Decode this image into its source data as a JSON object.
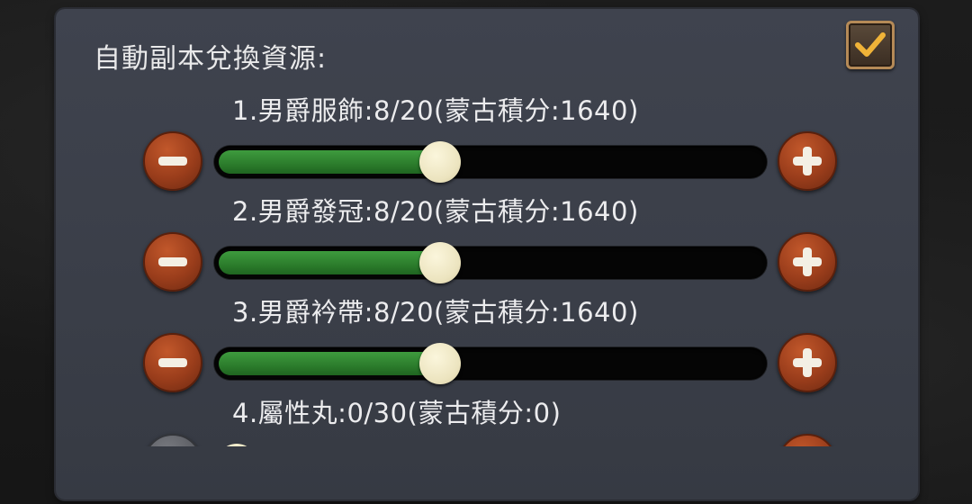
{
  "panel": {
    "title": "自動副本兌換資源:",
    "auto_exchange_checked": true
  },
  "colors": {
    "panel_bg": "#3c404a",
    "fill_green": "#2d7f2d",
    "button_active": "#9a3d1b",
    "button_disabled": "#5a5c62",
    "knob": "#ece4bf",
    "checkbox_border": "#b58a57",
    "checkmark": "#f0b338"
  },
  "rows": [
    {
      "label": "1.男爵服飾:8/20(蒙古積分:1640)",
      "current": 8,
      "max": 20,
      "points": 1640,
      "enabled": true
    },
    {
      "label": "2.男爵發冠:8/20(蒙古積分:1640)",
      "current": 8,
      "max": 20,
      "points": 1640,
      "enabled": true
    },
    {
      "label": "3.男爵衿帶:8/20(蒙古積分:1640)",
      "current": 8,
      "max": 20,
      "points": 1640,
      "enabled": true
    },
    {
      "label": "4.屬性丸:0/30(蒙古積分:0)",
      "current": 0,
      "max": 30,
      "points": 0,
      "enabled": false
    }
  ]
}
